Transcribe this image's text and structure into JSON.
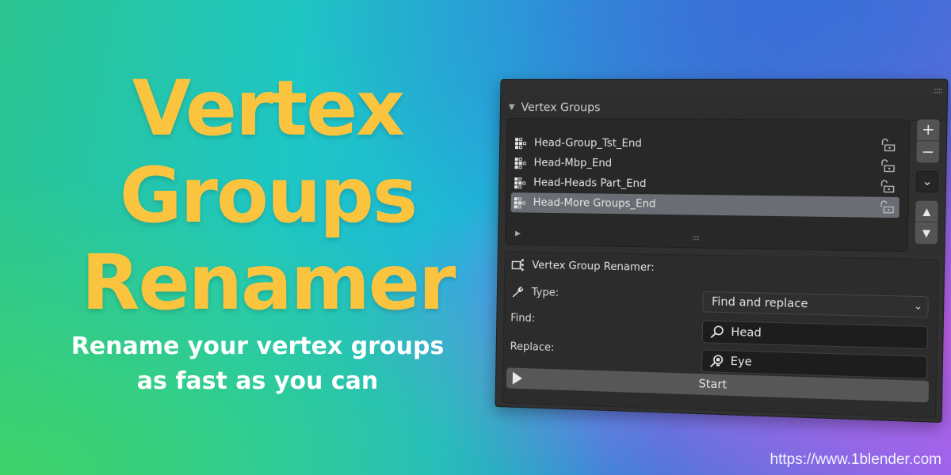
{
  "hero": {
    "title_lines": [
      "Vertex",
      "Groups",
      "Renamer"
    ],
    "subtitle_lines": [
      "Rename your vertex groups",
      "as fast as you can"
    ],
    "title_color": "#fbc43f"
  },
  "panel": {
    "section_title": "Vertex Groups",
    "vertex_groups": [
      {
        "name": "Head-Group_Tst_End",
        "selected": false,
        "lock_icon": "unlocked-icon"
      },
      {
        "name": "Head-Mbp_End",
        "selected": false,
        "lock_icon": "unlocked-icon"
      },
      {
        "name": "Head-Heads Part_End",
        "selected": false,
        "lock_icon": "unlocked-icon"
      },
      {
        "name": "Head-More Groups_End",
        "selected": true,
        "lock_icon": "unlocked-icon"
      }
    ],
    "side_buttons": {
      "add": "+",
      "remove": "−",
      "specials": "⌄",
      "move_up": "▲",
      "move_down": "▼"
    },
    "renamer": {
      "title": "Vertex Group Renamer:",
      "type_label": "Type:",
      "type_value": "Find and replace",
      "find_label": "Find:",
      "find_value": "Head",
      "replace_label": "Replace:",
      "replace_value": "Eye",
      "start_label": "Start"
    }
  },
  "footer": {
    "url": "https://www.1blender.com"
  }
}
